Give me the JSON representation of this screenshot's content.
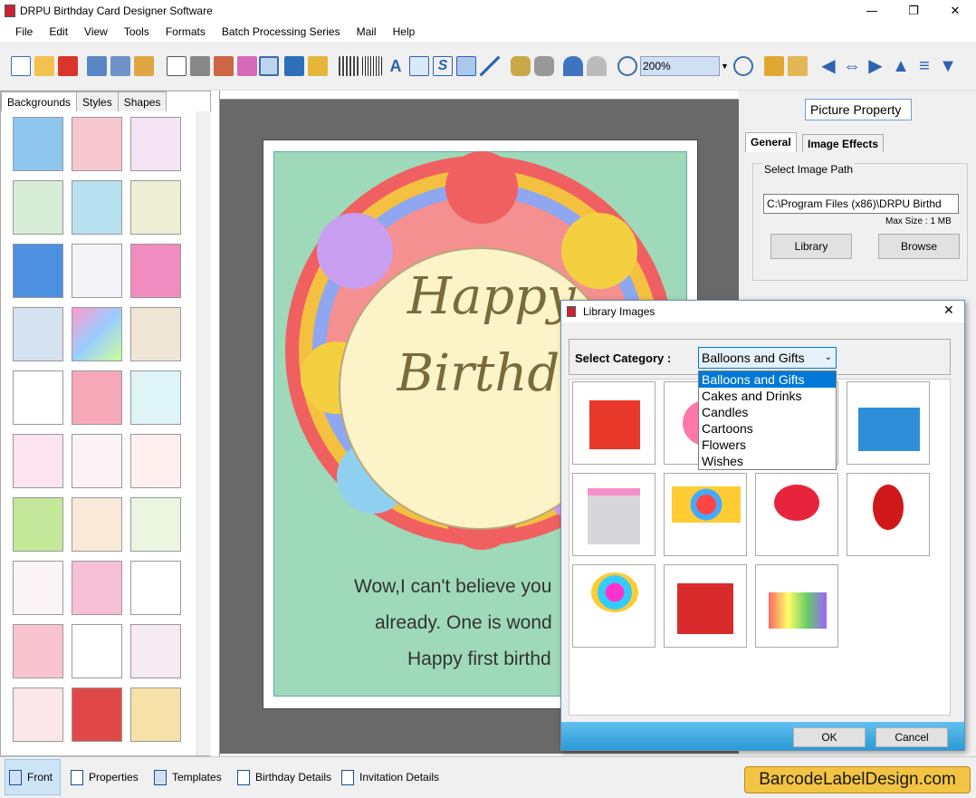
{
  "window": {
    "title": "DRPU Birthday Card Designer Software",
    "minimize": "—",
    "maximize": "❐",
    "close": "✕"
  },
  "menu": [
    "File",
    "Edit",
    "View",
    "Tools",
    "Formats",
    "Batch Processing Series",
    "Mail",
    "Help"
  ],
  "toolbar": {
    "zoom": "200%"
  },
  "left_tabs": [
    "Backgrounds",
    "Styles",
    "Shapes"
  ],
  "card": {
    "title_line1": "Happy",
    "title_line2": "Birthday",
    "msg_line1": "Wow,I can't believe you",
    "msg_line2": "already. One is wond",
    "msg_line3": "Happy first birthd"
  },
  "right": {
    "header": "Picture Property",
    "tab_general": "General",
    "tab_effects": "Image Effects",
    "select_path": "Select Image Path",
    "path_value": "C:\\Program Files (x86)\\DRPU Birthd",
    "max_size": "Max Size : 1 MB",
    "library": "Library",
    "browse": "Browse"
  },
  "dialog": {
    "title": "Library Images",
    "close": "✕",
    "category_label": "Select Category :",
    "category_value": "Balloons and Gifts",
    "options": [
      "Balloons and Gifts",
      "Cakes and Drinks",
      "Candles",
      "Cartoons",
      "Flowers",
      "Wishes"
    ],
    "ok": "OK",
    "cancel": "Cancel"
  },
  "bottom": {
    "front": "Front",
    "properties": "Properties",
    "templates": "Templates",
    "birthday_details": "Birthday Details",
    "invitation_details": "Invitation Details",
    "brand": "BarcodeLabelDesign.com"
  }
}
